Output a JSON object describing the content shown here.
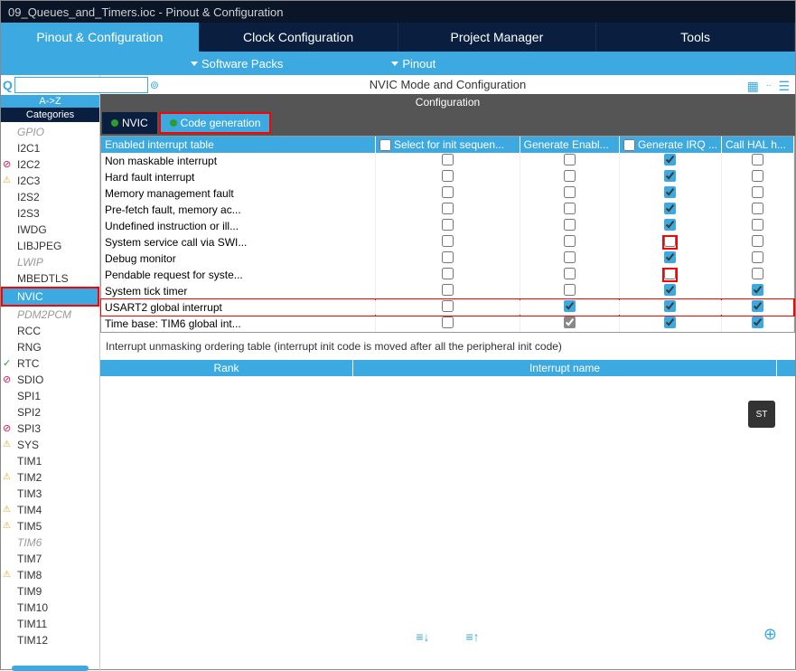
{
  "titlebar": "09_Queues_and_Timers.ioc - Pinout & Configuration",
  "main_tabs": [
    "Pinout & Configuration",
    "Clock Configuration",
    "Project Manager",
    "Tools"
  ],
  "main_tabs_active": 0,
  "sub_dropdowns": [
    "Software Packs",
    "Pinout"
  ],
  "left": {
    "az": "A->Z",
    "categories": "Categories",
    "items": [
      {
        "label": "GPIO",
        "cls": "disabled"
      },
      {
        "label": "I2C1"
      },
      {
        "label": "I2C2",
        "cls": "err"
      },
      {
        "label": "I2C3",
        "cls": "warn"
      },
      {
        "label": "I2S2"
      },
      {
        "label": "I2S3"
      },
      {
        "label": "IWDG"
      },
      {
        "label": "LIBJPEG"
      },
      {
        "label": "LWIP",
        "cls": "disabled"
      },
      {
        "label": "MBEDTLS"
      },
      {
        "label": "NVIC",
        "cls": "selected"
      },
      {
        "label": "PDM2PCM",
        "cls": "disabled"
      },
      {
        "label": "RCC"
      },
      {
        "label": "RNG"
      },
      {
        "label": "RTC",
        "cls": "ok"
      },
      {
        "label": "SDIO",
        "cls": "err"
      },
      {
        "label": "SPI1"
      },
      {
        "label": "SPI2"
      },
      {
        "label": "SPI3",
        "cls": "err"
      },
      {
        "label": "SYS",
        "cls": "warn"
      },
      {
        "label": "TIM1"
      },
      {
        "label": "TIM2",
        "cls": "warn"
      },
      {
        "label": "TIM3"
      },
      {
        "label": "TIM4",
        "cls": "warn"
      },
      {
        "label": "TIM5",
        "cls": "warn"
      },
      {
        "label": "TIM6",
        "cls": "disabled"
      },
      {
        "label": "TIM7"
      },
      {
        "label": "TIM8",
        "cls": "warn"
      },
      {
        "label": "TIM9"
      },
      {
        "label": "TIM10"
      },
      {
        "label": "TIM11"
      },
      {
        "label": "TIM12"
      }
    ]
  },
  "panel_title": "NVIC Mode and Configuration",
  "config_title": "Configuration",
  "inner_tabs": [
    "NVIC",
    "Code generation"
  ],
  "inner_tabs_active": 1,
  "table": {
    "headers": [
      "Enabled interrupt table",
      "Select for init sequen...",
      "Generate Enabl...",
      "Generate IRQ ...",
      "Call HAL h..."
    ],
    "header_checks": [
      null,
      false,
      null,
      false,
      null
    ],
    "rows": [
      {
        "name": "Non maskable interrupt",
        "c": [
          false,
          false,
          true,
          false
        ],
        "g": [
          false,
          false,
          false,
          false
        ]
      },
      {
        "name": "Hard fault interrupt",
        "c": [
          false,
          false,
          true,
          false
        ],
        "g": [
          false,
          false,
          false,
          false
        ]
      },
      {
        "name": "Memory management fault",
        "c": [
          false,
          false,
          true,
          false
        ],
        "g": [
          false,
          false,
          false,
          false
        ]
      },
      {
        "name": "Pre-fetch fault, memory ac...",
        "c": [
          false,
          false,
          true,
          false
        ],
        "g": [
          false,
          false,
          false,
          false
        ]
      },
      {
        "name": "Undefined instruction or ill...",
        "c": [
          false,
          false,
          true,
          false
        ],
        "g": [
          false,
          false,
          false,
          false
        ]
      },
      {
        "name": "System service call via SWI...",
        "c": [
          false,
          false,
          false,
          false
        ],
        "g": [
          false,
          false,
          false,
          false
        ],
        "hlcell": 2
      },
      {
        "name": "Debug monitor",
        "c": [
          false,
          false,
          true,
          false
        ],
        "g": [
          false,
          false,
          false,
          false
        ]
      },
      {
        "name": "Pendable request for syste...",
        "c": [
          false,
          false,
          false,
          false
        ],
        "g": [
          false,
          false,
          false,
          false
        ],
        "hlcell": 2
      },
      {
        "name": "System tick timer",
        "c": [
          false,
          false,
          true,
          true
        ],
        "g": [
          false,
          false,
          false,
          false
        ]
      },
      {
        "name": "USART2 global interrupt",
        "c": [
          false,
          true,
          true,
          true
        ],
        "g": [
          false,
          false,
          false,
          false
        ],
        "hlrow": true
      },
      {
        "name": "Time base: TIM6 global int...",
        "c": [
          false,
          true,
          true,
          true
        ],
        "g": [
          false,
          true,
          false,
          false
        ]
      }
    ]
  },
  "note": "Interrupt unmasking ordering table (interrupt init code is moved after all the peripheral init code)",
  "rank_headers": [
    "Rank",
    "Interrupt name"
  ]
}
